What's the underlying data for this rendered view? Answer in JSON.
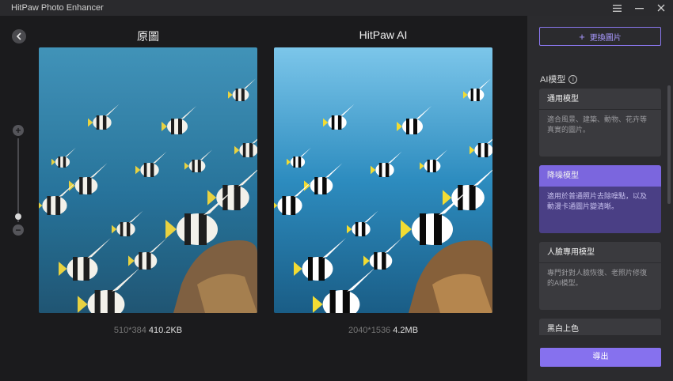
{
  "window": {
    "title": "HitPaw Photo Enhancer"
  },
  "titlebar": {
    "menu_icon": "menu-icon",
    "minimize_icon": "minimize-icon",
    "close_icon": "close-icon"
  },
  "preview": {
    "original": {
      "label": "原圖",
      "dimensions": "510*384",
      "filesize": "410.2KB"
    },
    "enhanced": {
      "label": "HitPaw AI",
      "dimensions": "2040*1536",
      "filesize": "4.2MB"
    }
  },
  "zoom": {
    "in_label": "+",
    "out_label": "−"
  },
  "sidebar": {
    "change_image_label": "更換圖片",
    "ai_model_label": "AI模型",
    "models": [
      {
        "title": "通用模型",
        "description": "適合風景、建築、動物、花卉等真實的圖片。",
        "selected": false
      },
      {
        "title": "降噪模型",
        "description": "適用於普通照片去除噪點，以及動漫卡通圖片變清晰。",
        "selected": true
      },
      {
        "title": "人臉專用模型",
        "description": "專門針對人臉恢復、老照片修復的AI模型。",
        "selected": false
      },
      {
        "title": "黑白上色",
        "description": "",
        "selected": false
      }
    ],
    "export_label": "導出"
  },
  "colors": {
    "accent": "#8671ee",
    "selected_card": "#4a3f85",
    "background": "#1b1b1d",
    "sidebar": "#2b2b2e"
  }
}
